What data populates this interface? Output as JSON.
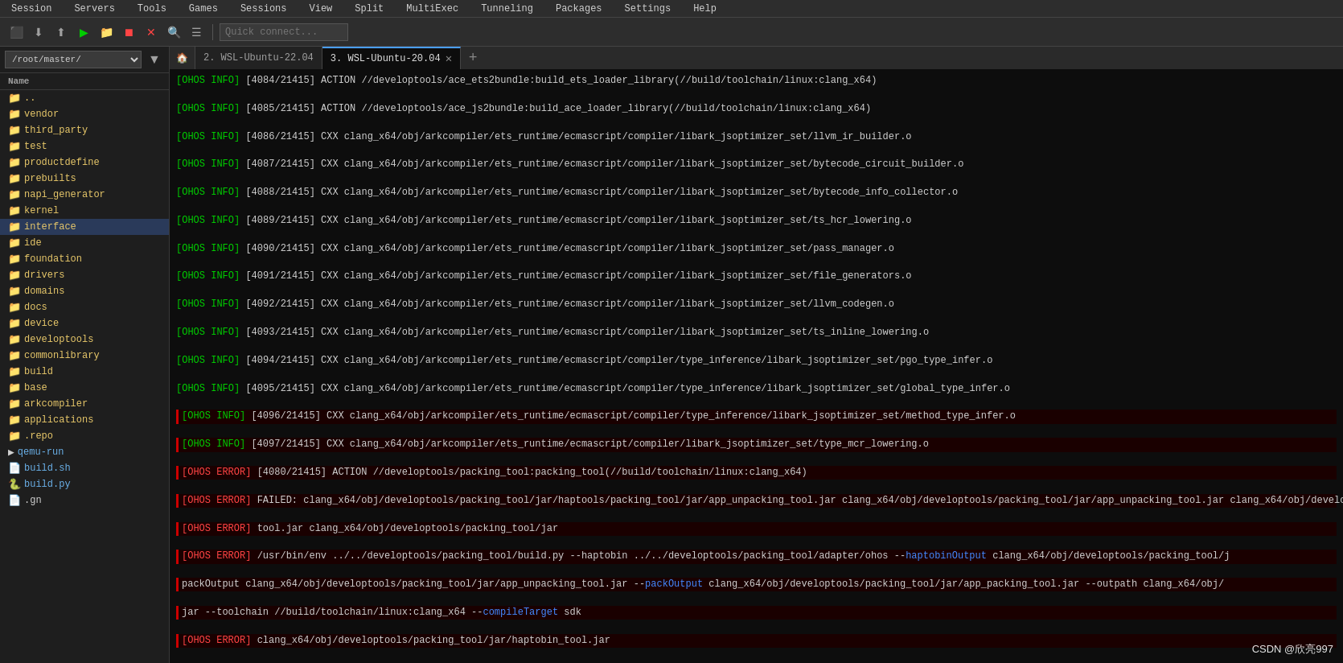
{
  "menubar": {
    "items": [
      "Session",
      "Servers",
      "Tools",
      "Games",
      "Sessions",
      "View",
      "Split",
      "MultiExec",
      "Tunneling",
      "Packages",
      "Settings",
      "Help"
    ]
  },
  "toolbar": {
    "quick_connect_placeholder": "Quick connect...",
    "path_value": "/root/master/"
  },
  "tabs": [
    {
      "id": "home",
      "label": "🏠",
      "active": false
    },
    {
      "id": "tab1",
      "label": "2. WSL-Ubuntu-22.04",
      "active": false
    },
    {
      "id": "tab2",
      "label": "3. WSL-Ubuntu-20.04",
      "active": true
    }
  ],
  "sidebar": {
    "header": "Name",
    "items": [
      {
        "type": "parent",
        "name": "..",
        "icon": "📁"
      },
      {
        "type": "folder",
        "name": "vendor",
        "icon": "📁"
      },
      {
        "type": "folder",
        "name": "third_party",
        "icon": "📁"
      },
      {
        "type": "folder",
        "name": "test",
        "icon": "📁"
      },
      {
        "type": "folder",
        "name": "productdefine",
        "icon": "📁"
      },
      {
        "type": "folder",
        "name": "prebuilts",
        "icon": "📁"
      },
      {
        "type": "folder",
        "name": "napi_generator",
        "icon": "📁"
      },
      {
        "type": "folder",
        "name": "kernel",
        "icon": "📁"
      },
      {
        "type": "folder",
        "name": "interface",
        "icon": "📁",
        "selected": true
      },
      {
        "type": "folder",
        "name": "ide",
        "icon": "📁"
      },
      {
        "type": "folder",
        "name": "foundation",
        "icon": "📁"
      },
      {
        "type": "folder",
        "name": "drivers",
        "icon": "📁"
      },
      {
        "type": "folder",
        "name": "domains",
        "icon": "📁"
      },
      {
        "type": "folder",
        "name": "docs",
        "icon": "📁"
      },
      {
        "type": "folder",
        "name": "device",
        "icon": "📁"
      },
      {
        "type": "folder",
        "name": "developtools",
        "icon": "📁"
      },
      {
        "type": "folder",
        "name": "commonlibrary",
        "icon": "📁"
      },
      {
        "type": "folder",
        "name": "build",
        "icon": "📁"
      },
      {
        "type": "folder",
        "name": "base",
        "icon": "📁"
      },
      {
        "type": "folder",
        "name": "arkcompiler",
        "icon": "📁"
      },
      {
        "type": "folder",
        "name": "applications",
        "icon": "📁"
      },
      {
        "type": "folder",
        "name": ".repo",
        "icon": "📁"
      },
      {
        "type": "script",
        "name": "qemu-run",
        "icon": "▶"
      },
      {
        "type": "script",
        "name": "build.sh",
        "icon": "📄"
      },
      {
        "type": "script",
        "name": "build.py",
        "icon": "🐍"
      },
      {
        "type": "file",
        "name": ".gn",
        "icon": "📄"
      }
    ]
  },
  "watermark": "CSDN @欣亮997"
}
